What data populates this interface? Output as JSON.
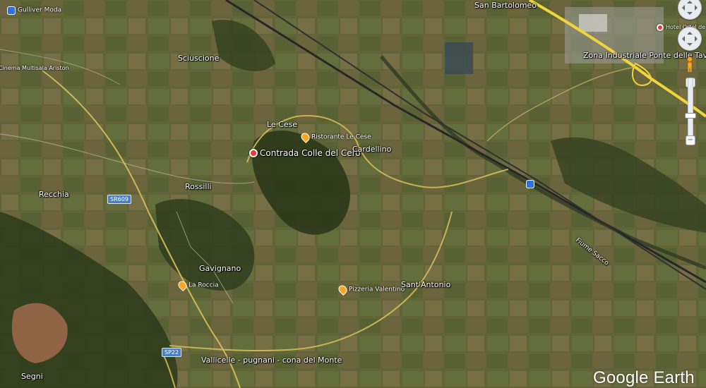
{
  "places": {
    "gulliver_moda": "Gulliver Moda",
    "sciuscione": "Sciuscione",
    "ariston": "Cinema Multisala Ariston",
    "le_cese": "Le Cese",
    "ristorante": "Ristorante Le Cese",
    "contrada": "Contrada Colle del Cero",
    "cardellino": "Cardellino",
    "rossilli": "Rossilli",
    "recchia": "Recchia",
    "gavignano": "Gavignano",
    "la_roccia": "La Roccia",
    "pizzeria": "Pizzeria Valentino",
    "sant_antonio": "Sant'Antonio",
    "segni": "Segni",
    "vallicelle": "Vallicelle - pugnani - cona del Monte",
    "san_bartolomeo": "San Bartolomeo",
    "zona_industriale": "Zona Industriale Ponte delle Tavole",
    "hotel": "Hotel Ortel de Pal",
    "fiume_sacco": "Fiume Sacco"
  },
  "road_shields": {
    "sr609": "SR609",
    "sp22": "SP22"
  },
  "controls": {
    "zoom_in": "+",
    "zoom_out": "−"
  },
  "branding": {
    "logo": "Google Earth"
  },
  "colors": {
    "terrain_base": "#5c6236",
    "forest": "#2e3a1a",
    "road_yellow": "#d8c25a",
    "highway": "#f2d43c",
    "railway": "#2b2b2b",
    "poi_orange": "#f5a623",
    "pin_red": "#e53935",
    "station_blue": "#2f6fe0"
  }
}
